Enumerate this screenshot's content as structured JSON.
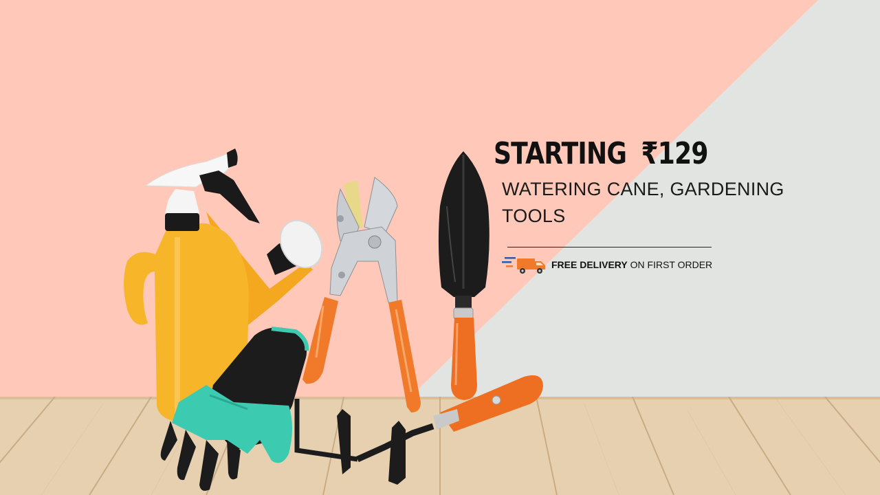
{
  "promo": {
    "headline_word": "STARTING",
    "price": "₹129",
    "subtitle": "WATERING CANE, GARDENING TOOLS",
    "delivery_bold": "FREE DELIVERY",
    "delivery_rest": " ON FIRST ORDER"
  },
  "icons": [
    "delivery-truck-icon"
  ],
  "colors": {
    "background_peach": "#ffc8b8",
    "background_grey": "#e1e4e0",
    "floor_wood": "#e6d0b0",
    "tool_orange": "#f07a2a",
    "can_yellow": "#f7b52a",
    "glove_teal": "#3ccab0",
    "text_dark": "#111111"
  }
}
